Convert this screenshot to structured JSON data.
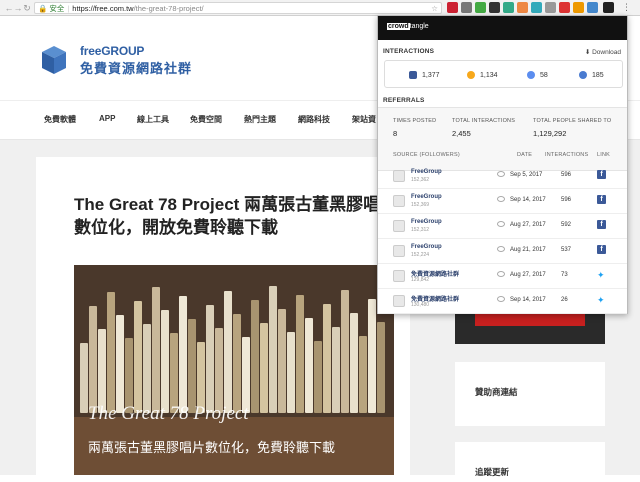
{
  "browser": {
    "secure_label": "安全",
    "url_host": "https://free.com.tw",
    "url_path": "/the-great-78-project/"
  },
  "site": {
    "brand_en": "freeGROUP",
    "brand_zh": "免費資源網路社群",
    "nav": [
      "免費軟體",
      "APP",
      "線上工具",
      "免費空間",
      "熱門主題",
      "網路科技",
      "架站資"
    ],
    "article_title": "The Great 78 Project 兩萬張古董黑膠唱片數位化，開放免費聆聽下載",
    "hero_en": "The Great 78 Project",
    "hero_zh": "兩萬張古董黑膠唱片數位化，免費聆聽下載",
    "sidebar_sponsor": "贊助商連結",
    "sidebar_latest": "追蹤更新"
  },
  "popup": {
    "brand_prefix": "crowd",
    "brand_suffix": "tangle",
    "interactions_label": "INTERACTIONS",
    "download_label": "Download",
    "interactions": [
      {
        "icon": "facebook-icon",
        "value": "1,377",
        "color": "#3b5998"
      },
      {
        "icon": "reactions-icon",
        "value": "1,134",
        "color": "#f7a81b"
      },
      {
        "icon": "comment-icon",
        "value": "58",
        "color": "#5b8def"
      },
      {
        "icon": "share-icon",
        "value": "185",
        "color": "#4a7bd0"
      }
    ],
    "referrals_label": "REFERRALS",
    "stats": [
      {
        "label": "TIMES POSTED",
        "value": "8"
      },
      {
        "label": "TOTAL INTERACTIONS",
        "value": "2,455"
      },
      {
        "label": "TOTAL PEOPLE SHARED TO",
        "value": "1,129,292"
      }
    ],
    "columns": [
      "SOURCE (FOLLOWERS)",
      "DATE",
      "INTERACTIONS",
      "LINK"
    ],
    "rows": [
      {
        "name": "FreeGroup",
        "followers": "152,362",
        "date": "Sep 5, 2017",
        "interactions": "596",
        "link": "facebook"
      },
      {
        "name": "FreeGroup",
        "followers": "152,369",
        "date": "Sep 14, 2017",
        "interactions": "596",
        "link": "facebook"
      },
      {
        "name": "FreeGroup",
        "followers": "152,312",
        "date": "Aug 27, 2017",
        "interactions": "592",
        "link": "facebook"
      },
      {
        "name": "FreeGroup",
        "followers": "152,224",
        "date": "Aug 21, 2017",
        "interactions": "537",
        "link": "facebook"
      },
      {
        "name": "免費資源網路社群",
        "followers": "129,842",
        "date": "Aug 27, 2017",
        "interactions": "73",
        "link": "twitter"
      },
      {
        "name": "免費資源網路社群",
        "followers": "130,480",
        "date": "Sep 14, 2017",
        "interactions": "26",
        "link": "twitter"
      }
    ]
  }
}
